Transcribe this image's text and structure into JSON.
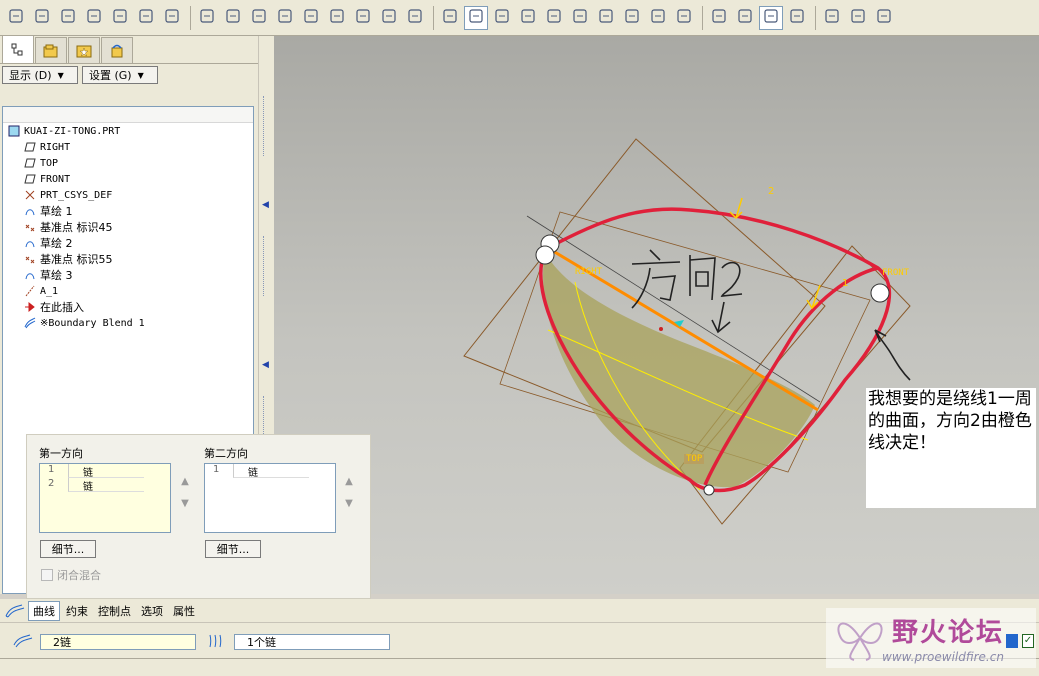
{
  "toolbar": {
    "buttons": [
      "new-icon",
      "open-icon",
      "save-icon",
      "print-icon",
      "send-icon",
      "send-all-icon",
      "undo-icon",
      "redo-icon",
      "cut-icon",
      "copy-icon",
      "paste-icon",
      "paste-special-icon",
      "regenerate-icon",
      "find-icon",
      "select-box-icon",
      "repaint-icon",
      "spin-center-icon",
      "orient-icon",
      "zoom-in-icon",
      "zoom-out-icon",
      "refit-icon",
      "reorient-icon",
      "saved-views-icon",
      "layers-icon",
      "view-manager-icon",
      "wireframe-icon",
      "hidden-line-icon",
      "no-hidden-icon",
      "shading-icon",
      "datum-planes-icon",
      "datum-axes-icon",
      "datum-points-icon",
      "coord-sys-icon"
    ]
  },
  "left_panel": {
    "display_button": "显示 (D)",
    "settings_button": "设置 (G)"
  },
  "model_tree": {
    "root": "KUAI-ZI-TONG.PRT",
    "items": [
      {
        "icon": "datum-plane-icon",
        "label": "RIGHT"
      },
      {
        "icon": "datum-plane-icon",
        "label": "TOP"
      },
      {
        "icon": "datum-plane-icon",
        "label": "FRONT"
      },
      {
        "icon": "coord-sys-icon",
        "label": "PRT_CSYS_DEF"
      },
      {
        "icon": "sketch-icon",
        "label": "草绘 1"
      },
      {
        "icon": "datum-point-icon",
        "label": "基准点 标识45"
      },
      {
        "icon": "sketch-icon",
        "label": "草绘 2"
      },
      {
        "icon": "datum-point-icon",
        "label": "基准点 标识55"
      },
      {
        "icon": "sketch-icon",
        "label": "草绘 3"
      },
      {
        "icon": "axis-icon",
        "label": "A_1"
      },
      {
        "icon": "insert-here-icon",
        "label": "在此插入"
      },
      {
        "icon": "boundary-blend-icon",
        "label": "※Boundary Blend 1"
      }
    ]
  },
  "viewport": {
    "labels": {
      "right": "RIGHT",
      "front": "FRONT",
      "top": "TOP",
      "dir1": "1",
      "dir2": "2"
    },
    "handwriting": "方向2",
    "colors": {
      "curve": "#e0203a",
      "edge": "#ff8c00",
      "surface": "#a8a25a",
      "plane": "#8a5a2a"
    }
  },
  "annotation": {
    "text": "我想要的是绕线1一周的曲面，方向2由橙色线决定！"
  },
  "direction_panel": {
    "first_label": "第一方向",
    "first_rows": [
      {
        "n": "1",
        "v": "链"
      },
      {
        "n": "2",
        "v": "链"
      }
    ],
    "second_label": "第二方向",
    "second_rows": [
      {
        "n": "1",
        "v": "链"
      }
    ],
    "detail_label": "细节...",
    "closed_blend": "闭合混合"
  },
  "bottom_tabs": [
    "曲线",
    "约束",
    "控制点",
    "选项",
    "属性"
  ],
  "chains": {
    "first": "2链",
    "second": "1个链"
  },
  "watermark": {
    "title": "野火论坛",
    "url": "www.proewildfire.cn"
  }
}
